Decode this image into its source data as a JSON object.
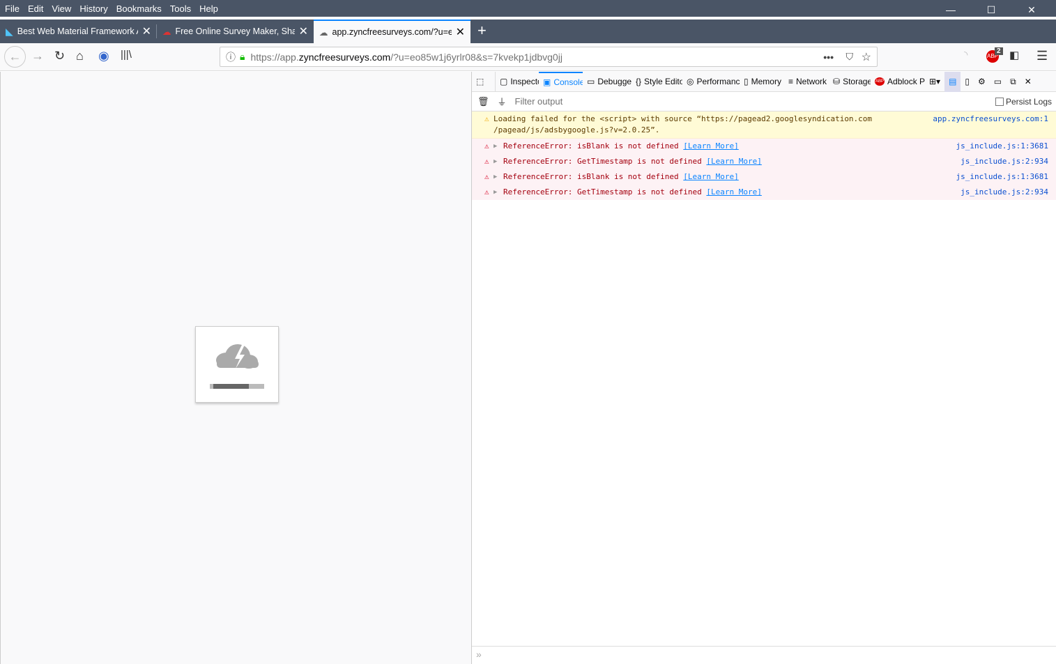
{
  "menu": [
    "File",
    "Edit",
    "View",
    "History",
    "Bookmarks",
    "Tools",
    "Help"
  ],
  "window": {
    "minimize": "—",
    "maximize": "☐",
    "close": "✕"
  },
  "tabs": [
    {
      "title": "Best Web Material Framework A",
      "icon": "material-logo-icon",
      "active": false
    },
    {
      "title": "Free Online Survey Maker, Share",
      "icon": "cloud-icon",
      "active": false
    },
    {
      "title": "app.zyncfreesurveys.com/?u=eo",
      "icon": "cloud-icon",
      "active": true
    }
  ],
  "url": {
    "prefix": "https://app.",
    "domain": "zyncfreesurveys.com",
    "rest": "/?u=eo85w1j6yrlr08&s=7kvekp1jdbvg0jj"
  },
  "toolbar": {
    "adblock_badge": "2"
  },
  "page": {
    "loader_progress": 0.7
  },
  "devtools": {
    "tabs": [
      "Inspector",
      "Console",
      "Debugger",
      "Style Editor",
      "Performance",
      "Memory",
      "Network",
      "Storage",
      "Adblock Plus"
    ],
    "selected_tab": "Console",
    "filter_placeholder": "Filter output",
    "persist_logs": "Persist Logs",
    "messages": [
      {
        "type": "warning",
        "text": "Loading failed for the <script> with source “https://pagead2.googlesyndication.com /pagead/js/adsbygoogle.js?v=2.0.25”.",
        "source": "app.zyncfreesurveys.com:1"
      },
      {
        "type": "error",
        "text": "ReferenceError: isBlank is not defined",
        "link": "[Learn More]",
        "source": "js_include.js:1:3681"
      },
      {
        "type": "error",
        "text": "ReferenceError: GetTimestamp is not defined",
        "link": "[Learn More]",
        "source": "js_include.js:2:934"
      },
      {
        "type": "error",
        "text": "ReferenceError: isBlank is not defined",
        "link": "[Learn More]",
        "source": "js_include.js:1:3681"
      },
      {
        "type": "error",
        "text": "ReferenceError: GetTimestamp is not defined",
        "link": "[Learn More]",
        "source": "js_include.js:2:934"
      }
    ],
    "prompt": "»"
  }
}
